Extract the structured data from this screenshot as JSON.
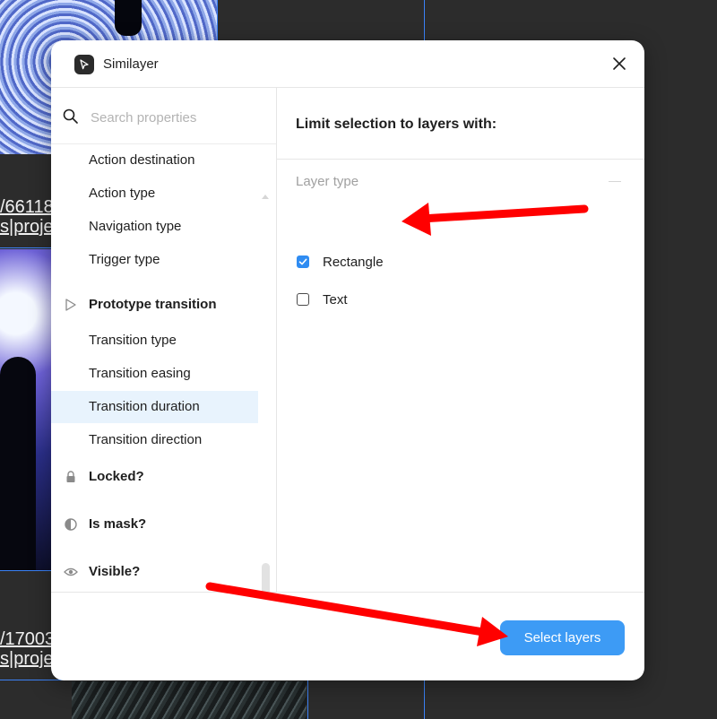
{
  "canvas": {
    "url_fragment_top_line1": "/66118",
    "url_fragment_top_line2": "s|proje",
    "url_fragment_bottom_line1": "/17003",
    "url_fragment_bottom_line2": "s|proje",
    "selection_color": "#3b82f6"
  },
  "dialog": {
    "app_title": "Similayer",
    "app_icon": "cursor-arrow-icon",
    "close_icon": "close-icon"
  },
  "search": {
    "placeholder": "Search properties",
    "value": ""
  },
  "properties": {
    "items": [
      {
        "label": "Action destination"
      },
      {
        "label": "Action type"
      },
      {
        "label": "Navigation type"
      },
      {
        "label": "Trigger type"
      }
    ],
    "prototype_group": {
      "label": "Prototype transition",
      "icon": "play-triangle-icon",
      "items": [
        {
          "label": "Transition type"
        },
        {
          "label": "Transition easing"
        },
        {
          "label": "Transition duration",
          "active": true
        },
        {
          "label": "Transition direction"
        }
      ]
    },
    "locked": {
      "label": "Locked?",
      "icon": "lock-icon"
    },
    "is_mask": {
      "label": "Is mask?",
      "icon": "half-circle-icon"
    },
    "visible": {
      "label": "Visible?",
      "icon": "eye-icon"
    }
  },
  "right_panel": {
    "title": "Limit selection to layers with:",
    "section_label": "Layer type",
    "options": [
      {
        "label": "Rectangle",
        "checked": true
      },
      {
        "label": "Text",
        "checked": false
      }
    ]
  },
  "footer": {
    "select_button_label": "Select layers",
    "button_color": "#3d9bf5"
  },
  "annotation_color": "#ff0000"
}
